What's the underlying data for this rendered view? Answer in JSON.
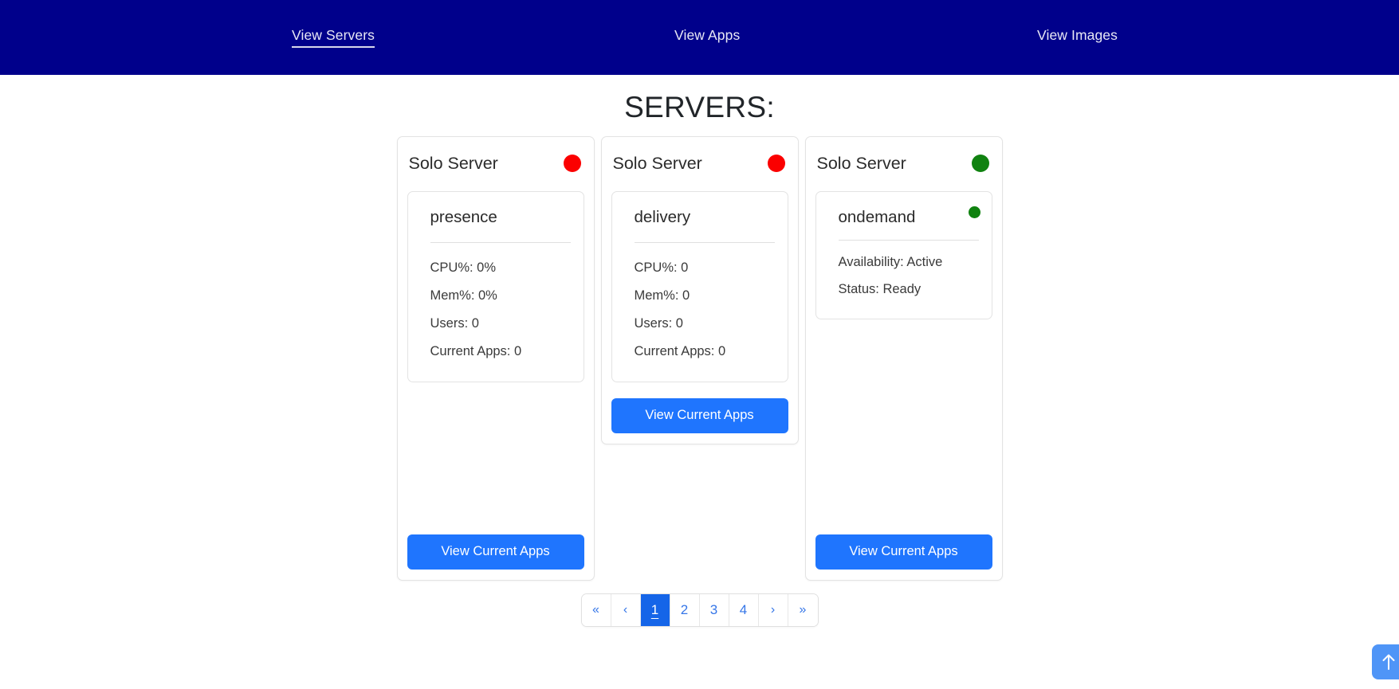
{
  "nav": {
    "links": [
      {
        "label": "View Servers",
        "active": true
      },
      {
        "label": "View Apps",
        "active": false
      },
      {
        "label": "View Images",
        "active": false
      }
    ]
  },
  "page": {
    "title": "SERVERS:"
  },
  "cards": [
    {
      "header_title": "Solo Server",
      "status_color": "#fb0000",
      "status_name": "red",
      "inner": {
        "name": "presence",
        "has_inner_dot": false,
        "stats": [
          "CPU%: 0%",
          "Mem%: 0%",
          "Users: 0",
          "Current Apps: 0"
        ]
      },
      "button_label": "View Current Apps"
    },
    {
      "header_title": "Solo Server",
      "status_color": "#fb0000",
      "status_name": "red",
      "inner": {
        "name": "delivery",
        "has_inner_dot": false,
        "stats": [
          "CPU%: 0",
          "Mem%: 0",
          "Users: 0",
          "Current Apps: 0"
        ]
      },
      "button_label": "View Current Apps"
    },
    {
      "header_title": "Solo Server",
      "status_color": "#108210",
      "status_name": "green",
      "inner": {
        "name": "ondemand",
        "has_inner_dot": true,
        "inner_dot_color": "#108210",
        "stats": [
          "Availability: Active",
          "Status: Ready"
        ]
      },
      "button_label": "View Current Apps"
    }
  ],
  "pagination": {
    "items": [
      {
        "label": "«",
        "type": "first",
        "active": false
      },
      {
        "label": "‹",
        "type": "prev",
        "active": false
      },
      {
        "label": "1",
        "type": "page",
        "active": true
      },
      {
        "label": "2",
        "type": "page",
        "active": false
      },
      {
        "label": "3",
        "type": "page",
        "active": false
      },
      {
        "label": "4",
        "type": "page",
        "active": false
      },
      {
        "label": "›",
        "type": "next",
        "active": false
      },
      {
        "label": "»",
        "type": "last",
        "active": false
      }
    ]
  },
  "scroll_top": {
    "icon": "arrow-up-icon"
  },
  "colors": {
    "navbar": "#00008B",
    "button_blue": "#1f75fe",
    "pagination_active": "#1565e8",
    "status_red": "#fb0000",
    "status_green": "#108210"
  }
}
